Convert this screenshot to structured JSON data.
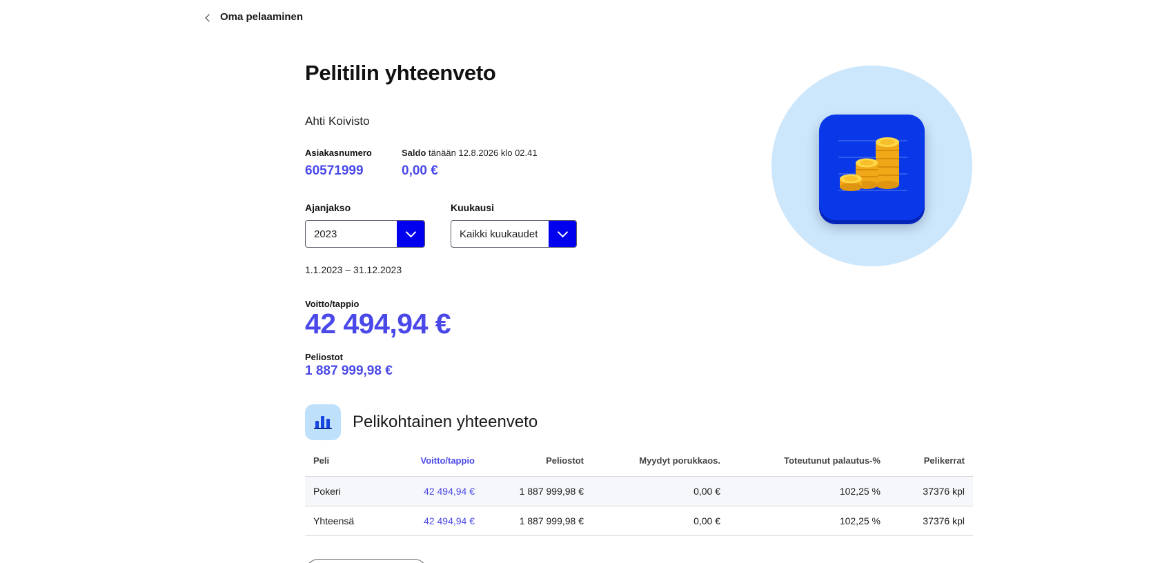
{
  "back": {
    "label": "Oma pelaaminen",
    "icon": "chevron-left-icon"
  },
  "title": "Pelitilin yhteenveto",
  "customer_name": "Ahti Koivisto",
  "account": {
    "label": "Asiakasnumero",
    "value": "60571999"
  },
  "balance": {
    "label": "Saldo",
    "date_text": "tänään 12.8.2026 klo 02.41",
    "value": "0,00 €"
  },
  "filters": {
    "period": {
      "label": "Ajanjakso",
      "value": "2023"
    },
    "month": {
      "label": "Kuukausi",
      "value": "Kaikki kuukaudet"
    }
  },
  "date_range": "1.1.2023 – 31.12.2023",
  "win_loss": {
    "label": "Voitto/tappio",
    "value": "42 494,94 €"
  },
  "stakes": {
    "label": "Peliostot",
    "value": "1 887 999,98 €"
  },
  "section": {
    "title": "Pelikohtainen yhteenveto",
    "icon": "bar-chart-icon"
  },
  "table": {
    "headers": [
      "Peli",
      "Voitto/tappio",
      "Peliostot",
      "Myydyt porukkaos.",
      "Toteutunut palautus-%",
      "Pelikerrat"
    ],
    "rows": [
      [
        "Pokeri",
        "42 494,94 €",
        "1 887 999,98 €",
        "0,00 €",
        "102,25 %",
        "37376 kpl"
      ],
      [
        "Yhteensä",
        "42 494,94 €",
        "1 887 999,98 €",
        "0,00 €",
        "102,25 %",
        "37376 kpl"
      ]
    ]
  },
  "colors": {
    "accent": "#4a48e8",
    "select_button": "#0000ee",
    "hero_bg": "#cce6fb",
    "app_icon": "#0838e8"
  },
  "hero_icon": "coins-icon"
}
